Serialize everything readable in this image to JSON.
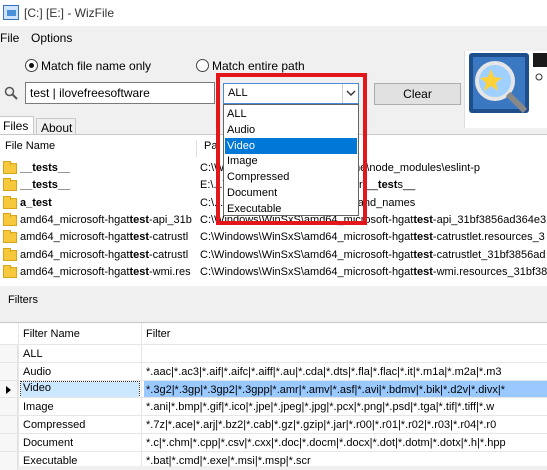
{
  "window": {
    "title": "[C:] [E:] - WizFile"
  },
  "menu": {
    "items": [
      "File",
      "Options"
    ]
  },
  "match_mode": {
    "options": [
      "Match file name only",
      "Match entire path"
    ],
    "selected": "Match file name only"
  },
  "search": {
    "value": "test | ilovefreesoftware"
  },
  "filter_select": {
    "value": "ALL"
  },
  "clear_button": {
    "label": "Clear"
  },
  "dropdown": {
    "options": [
      "ALL",
      "Audio",
      "Video",
      "Image",
      "Compressed",
      "Document",
      "Executable"
    ],
    "selected": "Video"
  },
  "tabs": {
    "files": "Files",
    "about": "About"
  },
  "files_table": {
    "headers": {
      "name": "File Name",
      "path": "Pa"
    },
    "rows": [
      {
        "name": "__tests__",
        "path": "C:\\Windows\\...\\downloads\\resume\\node_modules\\eslint-p",
        "dir": true
      },
      {
        "name": "__tests__",
        "path": "E:\\...\\cursor-source\\contrib\\cursor\\__tests__",
        "dir": true
      },
      {
        "name": "a_test",
        "path": "C:\\...\\gamespace_pkgs\\module_and_names",
        "dir": true
      },
      {
        "name": "amd64_microsoft-hgattest-api_31b",
        "path": "C:\\Windows\\WinSxS\\amd64_microsoft-hgattest-api_31bf3856ad364e3",
        "dir": false
      },
      {
        "name": "amd64_microsoft-hgattest-catrustl",
        "path": "C:\\Windows\\WinSxS\\amd64_microsoft-hgattest-catrustlet.resources_3",
        "dir": false
      },
      {
        "name": "amd64_microsoft-hgattest-catrustl",
        "path": "C:\\Windows\\WinSxS\\amd64_microsoft-hgattest-catrustlet_31bf3856ad",
        "dir": false
      },
      {
        "name": "amd64_microsoft-hgattest-wmi.res",
        "path": "C:\\Windows\\WinSxS\\amd64_microsoft-hgattest-wmi.resources_31bf3856",
        "dir": false
      }
    ]
  },
  "filters": {
    "label": "Filters",
    "headers": {
      "name": "Filter Name",
      "pattern": "Filter"
    },
    "rows": [
      {
        "name": "ALL",
        "pattern": ""
      },
      {
        "name": "Audio",
        "pattern": "*.aac|*.ac3|*.aif|*.aifc|*.aiff|*.au|*.cda|*.dts|*.fla|*.flac|*.it|*.m1a|*.m2a|*.m3"
      },
      {
        "name": "Video",
        "pattern": "*.3g2|*.3gp|*.3gp2|*.3gpp|*.amr|*.amv|*.asf|*.avi|*.bdmv|*.bik|*.d2v|*.divx|*"
      },
      {
        "name": "Image",
        "pattern": "*.ani|*.bmp|*.gif|*.ico|*.jpe|*.jpeg|*.jpg|*.pcx|*.png|*.psd|*.tga|*.tif|*.tiff|*.w"
      },
      {
        "name": "Compressed",
        "pattern": "*.7z|*.ace|*.arj|*.bz2|*.cab|*.gz|*.gzip|*.jar|*.r00|*.r01|*.r02|*.r03|*.r04|*.r0"
      },
      {
        "name": "Document",
        "pattern": "*.c|*.chm|*.cpp|*.csv|*.cxx|*.doc|*.docm|*.docx|*.dot|*.dotm|*.dotx|*.h|*.hpp"
      },
      {
        "name": "Executable",
        "pattern": "*.bat|*.cmd|*.exe|*.msi|*.msp|*.scr"
      }
    ],
    "selected": "Video"
  },
  "colors": {
    "highlight_box": "#e3161c",
    "selection": "#0078d7",
    "row_selection": "#99c9ff"
  }
}
